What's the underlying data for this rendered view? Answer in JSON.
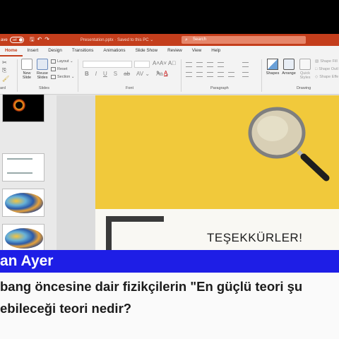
{
  "titlebar": {
    "autosave_label": "ave",
    "toggle_label": "Off",
    "filename": "Presentation.pptx · Saved to this PC ⌄",
    "search_placeholder": "Search"
  },
  "tabs": [
    "Home",
    "Insert",
    "Design",
    "Transitions",
    "Animations",
    "Slide Show",
    "Review",
    "View",
    "Help"
  ],
  "ribbon": {
    "new_slide": "New\nSlide",
    "reuse_slides": "Reuse\nSlides",
    "layout": "Layout ⌄",
    "reset": "Reset",
    "section": "Section ⌄",
    "shapes": "Shapes",
    "arrange": "Arrange",
    "quick_styles": "Quick\nStyles",
    "shape_fill": "Shape Fill",
    "shape_outline": "Shape Outl",
    "shape_effects": "Shape Effe",
    "groups": {
      "clipboard": "ard",
      "slides": "Slides",
      "font": "Font",
      "paragraph": "Paragraph",
      "drawing": "Drawing"
    },
    "format_buttons": [
      "B",
      "I",
      "U",
      "S",
      "ab",
      "AV ⌄",
      "Aa ⌄"
    ],
    "colors": {
      "accent": "#c43e1c"
    }
  },
  "slide": {
    "thanks_text": "TEŞEKKÜRLER!"
  },
  "caption": {
    "name": "an Ayer",
    "question_line1": "bang öncesine dair fizikçilerin \"En güçlü teori şu",
    "question_line2": "ebileceği teori nedir?",
    "bar_color": "#1e1ee6"
  }
}
